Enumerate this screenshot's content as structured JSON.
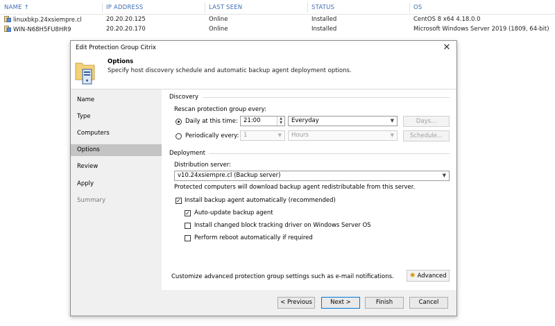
{
  "table": {
    "columns": [
      "NAME",
      "IP ADDRESS",
      "LAST SEEN",
      "STATUS",
      "OS"
    ],
    "sort_arrow": "↑",
    "rows": [
      {
        "name": "linuxbkp.24xsiempre.cl",
        "ip": "20.20.20.125",
        "last_seen": "Online",
        "status": "Installed",
        "os": "CentOS 8 x64 4.18.0.0"
      },
      {
        "name": "WIN-N68H5FU8HR9",
        "ip": "20.20.20.170",
        "last_seen": "Online",
        "status": "Installed",
        "os": "Microsoft Windows Server 2019 (1809, 64-bit)"
      }
    ]
  },
  "dialog": {
    "title": "Edit Protection Group Citrix",
    "close_glyph": "✕",
    "header": {
      "title": "Options",
      "subtitle": "Specify host discovery schedule and automatic backup agent deployment options."
    },
    "nav": [
      {
        "label": "Name",
        "state": "normal"
      },
      {
        "label": "Type",
        "state": "normal"
      },
      {
        "label": "Computers",
        "state": "normal"
      },
      {
        "label": "Options",
        "state": "active"
      },
      {
        "label": "Review",
        "state": "normal"
      },
      {
        "label": "Apply",
        "state": "normal"
      },
      {
        "label": "Summary",
        "state": "disabled"
      }
    ],
    "discovery": {
      "group_label": "Discovery",
      "rescan_label": "Rescan protection group every:",
      "daily_label": "Daily at this time:",
      "daily_checked": true,
      "time_value": "21:00",
      "frequency_value": "Everyday",
      "days_button": "Days...",
      "periodically_label": "Periodically every:",
      "periodically_checked": false,
      "period_value": "1",
      "period_unit": "Hours",
      "schedule_button": "Schedule..."
    },
    "deployment": {
      "group_label": "Deployment",
      "server_label": "Distribution server:",
      "server_value": "v10.24xsiempre.cl (Backup server)",
      "info_text": "Protected computers will download backup agent redistributable from this server.",
      "install_label": "Install backup agent automatically (recommended)",
      "install_checked": true,
      "autoupdate_label": "Auto-update backup agent",
      "autoupdate_checked": true,
      "cbt_label": "Install changed block tracking driver on Windows Server OS",
      "cbt_checked": false,
      "reboot_label": "Perform reboot automatically if required",
      "reboot_checked": false
    },
    "advanced": {
      "text": "Customize advanced protection group settings such as e-mail notifications.",
      "button": "Advanced"
    },
    "footer": {
      "previous": "< Previous",
      "next": "Next >",
      "finish": "Finish",
      "cancel": "Cancel"
    }
  },
  "colors": {
    "header_text": "#3d6db5",
    "nav_bg": "#f0f0f0",
    "nav_active": "#c4c4c4",
    "default_button_border": "#0078d7"
  }
}
